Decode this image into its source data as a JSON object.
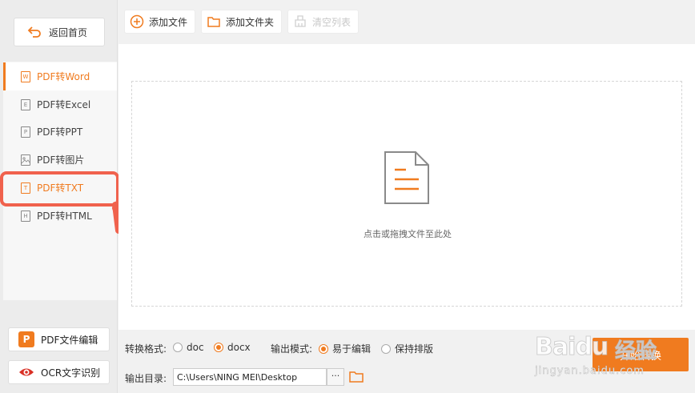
{
  "sidebar": {
    "back_label": "返回首页",
    "items": [
      {
        "label": "PDF转Word",
        "icon": "W",
        "active": true
      },
      {
        "label": "PDF转Excel",
        "icon": "E",
        "active": false
      },
      {
        "label": "PDF转PPT",
        "icon": "P",
        "active": false
      },
      {
        "label": "PDF转图片",
        "icon": "image",
        "active": false
      },
      {
        "label": "PDF转TXT",
        "icon": "T",
        "active": false
      },
      {
        "label": "PDF转HTML",
        "icon": "H",
        "active": false
      }
    ],
    "tools": [
      {
        "label": "PDF文件编辑",
        "icon": "P",
        "color": "#f07b1f"
      },
      {
        "label": "OCR文字识别",
        "icon": "eye",
        "color": "#d93025"
      }
    ]
  },
  "toolbar": {
    "add_file": "添加文件",
    "add_folder": "添加文件夹",
    "clear_list": "清空列表"
  },
  "drop_zone": {
    "hint": "点击或拖拽文件至此处"
  },
  "bottom": {
    "format_label": "转换格式:",
    "format_options": [
      {
        "label": "doc",
        "checked": false
      },
      {
        "label": "docx",
        "checked": true
      }
    ],
    "mode_label": "输出模式:",
    "mode_options": [
      {
        "label": "易于编辑",
        "checked": true
      },
      {
        "label": "保持排版",
        "checked": false
      }
    ],
    "dir_label": "输出目录:",
    "dir_value": "C:\\Users\\NING MEI\\Desktop",
    "browse_label": "···",
    "start_label": "开始转换"
  },
  "watermark": {
    "logo": "Baidu",
    "brand": "经验",
    "url": "jingyan.baidu.com"
  },
  "colors": {
    "accent": "#f07b1f",
    "highlight": "#f0624d"
  }
}
